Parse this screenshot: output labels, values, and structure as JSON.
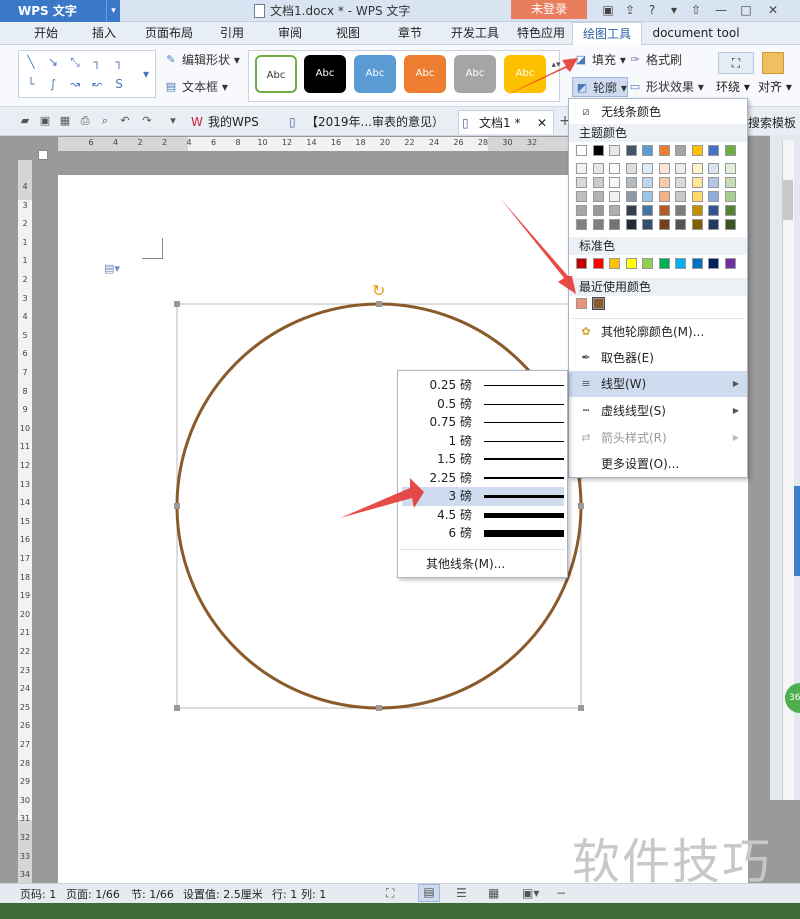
{
  "titlebar": {
    "app_name": "WPS 文字",
    "doc_title": "文档1.docx * - WPS 文字",
    "login_label": "未登录"
  },
  "ribbon_tabs": [
    "开始",
    "插入",
    "页面布局",
    "引用",
    "审阅",
    "视图",
    "章节",
    "开发工具",
    "特色应用",
    "绘图工具",
    "document tool"
  ],
  "ribbon": {
    "edit_shape": "编辑形状",
    "text_box": "文本框",
    "style_sample": "Abc",
    "fill": "填充",
    "format_painter": "格式刷",
    "outline": "轮廓",
    "shape_effect": "形状效果",
    "wrap": "环绕",
    "align": "对齐"
  },
  "doc_tabs": {
    "mywps": "我的WPS",
    "tab2": "【2019年...审表的意见）",
    "tab3": "文档1 *",
    "template": "搜索模板"
  },
  "outline_menu": {
    "no_line": "无线条颜色",
    "theme_colors": "主题颜色",
    "standard_colors": "标准色",
    "recent_colors": "最近使用颜色",
    "more_colors": "其他轮廓颜色(M)...",
    "eyedropper": "取色器(E)",
    "line_style": "线型(W)",
    "dash_style": "虚线线型(S)",
    "arrow_style": "箭头样式(R)",
    "more_settings": "更多设置(O)..."
  },
  "theme_palette_top": [
    "#ffffff",
    "#000000",
    "#e8e8e8",
    "#44546a",
    "#5b9bd5",
    "#ed7d31",
    "#a5a5a5",
    "#ffc000",
    "#4472c4",
    "#70ad47"
  ],
  "standard_palette": [
    "#c00000",
    "#ff0000",
    "#ffc000",
    "#ffff00",
    "#92d050",
    "#00b050",
    "#00b0f0",
    "#0070c0",
    "#002060",
    "#7030a0"
  ],
  "recent_palette": [
    "#e8957a",
    "#8b5a2b"
  ],
  "line_weight_menu": {
    "items": [
      {
        "label": "0.25 磅",
        "weight": 0.25
      },
      {
        "label": "0.5 磅",
        "weight": 0.5
      },
      {
        "label": "0.75 磅",
        "weight": 0.75
      },
      {
        "label": "1 磅",
        "weight": 1
      },
      {
        "label": "1.5 磅",
        "weight": 1.5
      },
      {
        "label": "2.25 磅",
        "weight": 2.25
      },
      {
        "label": "3 磅",
        "weight": 3
      },
      {
        "label": "4.5 磅",
        "weight": 4.5
      },
      {
        "label": "6 磅",
        "weight": 6
      }
    ],
    "selected": "3 磅",
    "other": "其他线条(M)..."
  },
  "ruler_numbers": [
    "6",
    "4",
    "2",
    "2",
    "4",
    "6",
    "8",
    "10",
    "12",
    "14",
    "16",
    "18",
    "20",
    "22",
    "24",
    "26",
    "28",
    "30",
    "32"
  ],
  "vruler_numbers": [
    "4",
    "3",
    "2",
    "1",
    "1",
    "2",
    "3",
    "4",
    "5",
    "6",
    "7",
    "8",
    "9",
    "10",
    "11",
    "12",
    "13",
    "14",
    "15",
    "16",
    "17",
    "18",
    "19",
    "20",
    "21",
    "22",
    "23",
    "24",
    "25",
    "26",
    "27",
    "28",
    "29",
    "30",
    "31",
    "32",
    "33",
    "34"
  ],
  "status": {
    "page_code": "页码: 1",
    "page": "页面: 1/66",
    "section": "节: 1/66",
    "setting": "设置值: 2.5厘米",
    "row": "行: 1",
    "col": "列: 1"
  },
  "circle_color": "#8b5a2b",
  "badge": "36",
  "watermark": "软件技巧"
}
